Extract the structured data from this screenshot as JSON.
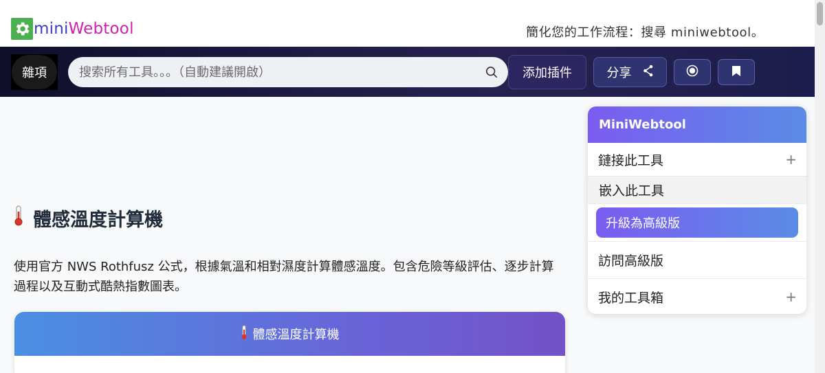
{
  "brand": {
    "mini": "mini",
    "webtool": "Webtool",
    "tagline": "簡化您的工作流程：搜尋 miniwebtool。"
  },
  "navbar": {
    "misc_label": "雜項",
    "search_placeholder": "搜索所有工具。。。（自動建議開啟）",
    "addon_label": "添加插件",
    "share_label": "分享"
  },
  "main": {
    "title": "體感溫度計算機",
    "description": "使用官方 NWS Rothfusz 公式，根據氣溫和相對濕度計算體感溫度。包含危險等級評估、逐步計算過程以及互動式酷熱指數圖表。",
    "card_title": "體感溫度計算機"
  },
  "sidebar": {
    "header": "MiniWebtool",
    "items": [
      {
        "label": "鏈接此工具",
        "expandable": true
      },
      {
        "label": "嵌入此工具"
      },
      {
        "label": "升級為高級版"
      },
      {
        "label": "訪問高級版"
      },
      {
        "label": "我的工具箱",
        "expandable": true
      }
    ],
    "plus_symbol": "+"
  },
  "colors": {
    "navbar": "#1c1a44",
    "accent_purple": "#7b5cf0",
    "accent_blue": "#5a8ce6",
    "logo_green": "#4caf50",
    "logo_mini": "#3b3bd1",
    "logo_webtool": "#d11fb0"
  },
  "icons": [
    "gear-icon",
    "search-icon",
    "share-icon",
    "record-icon",
    "bookmark-icon",
    "thermometer-icon",
    "plus-icon"
  ]
}
